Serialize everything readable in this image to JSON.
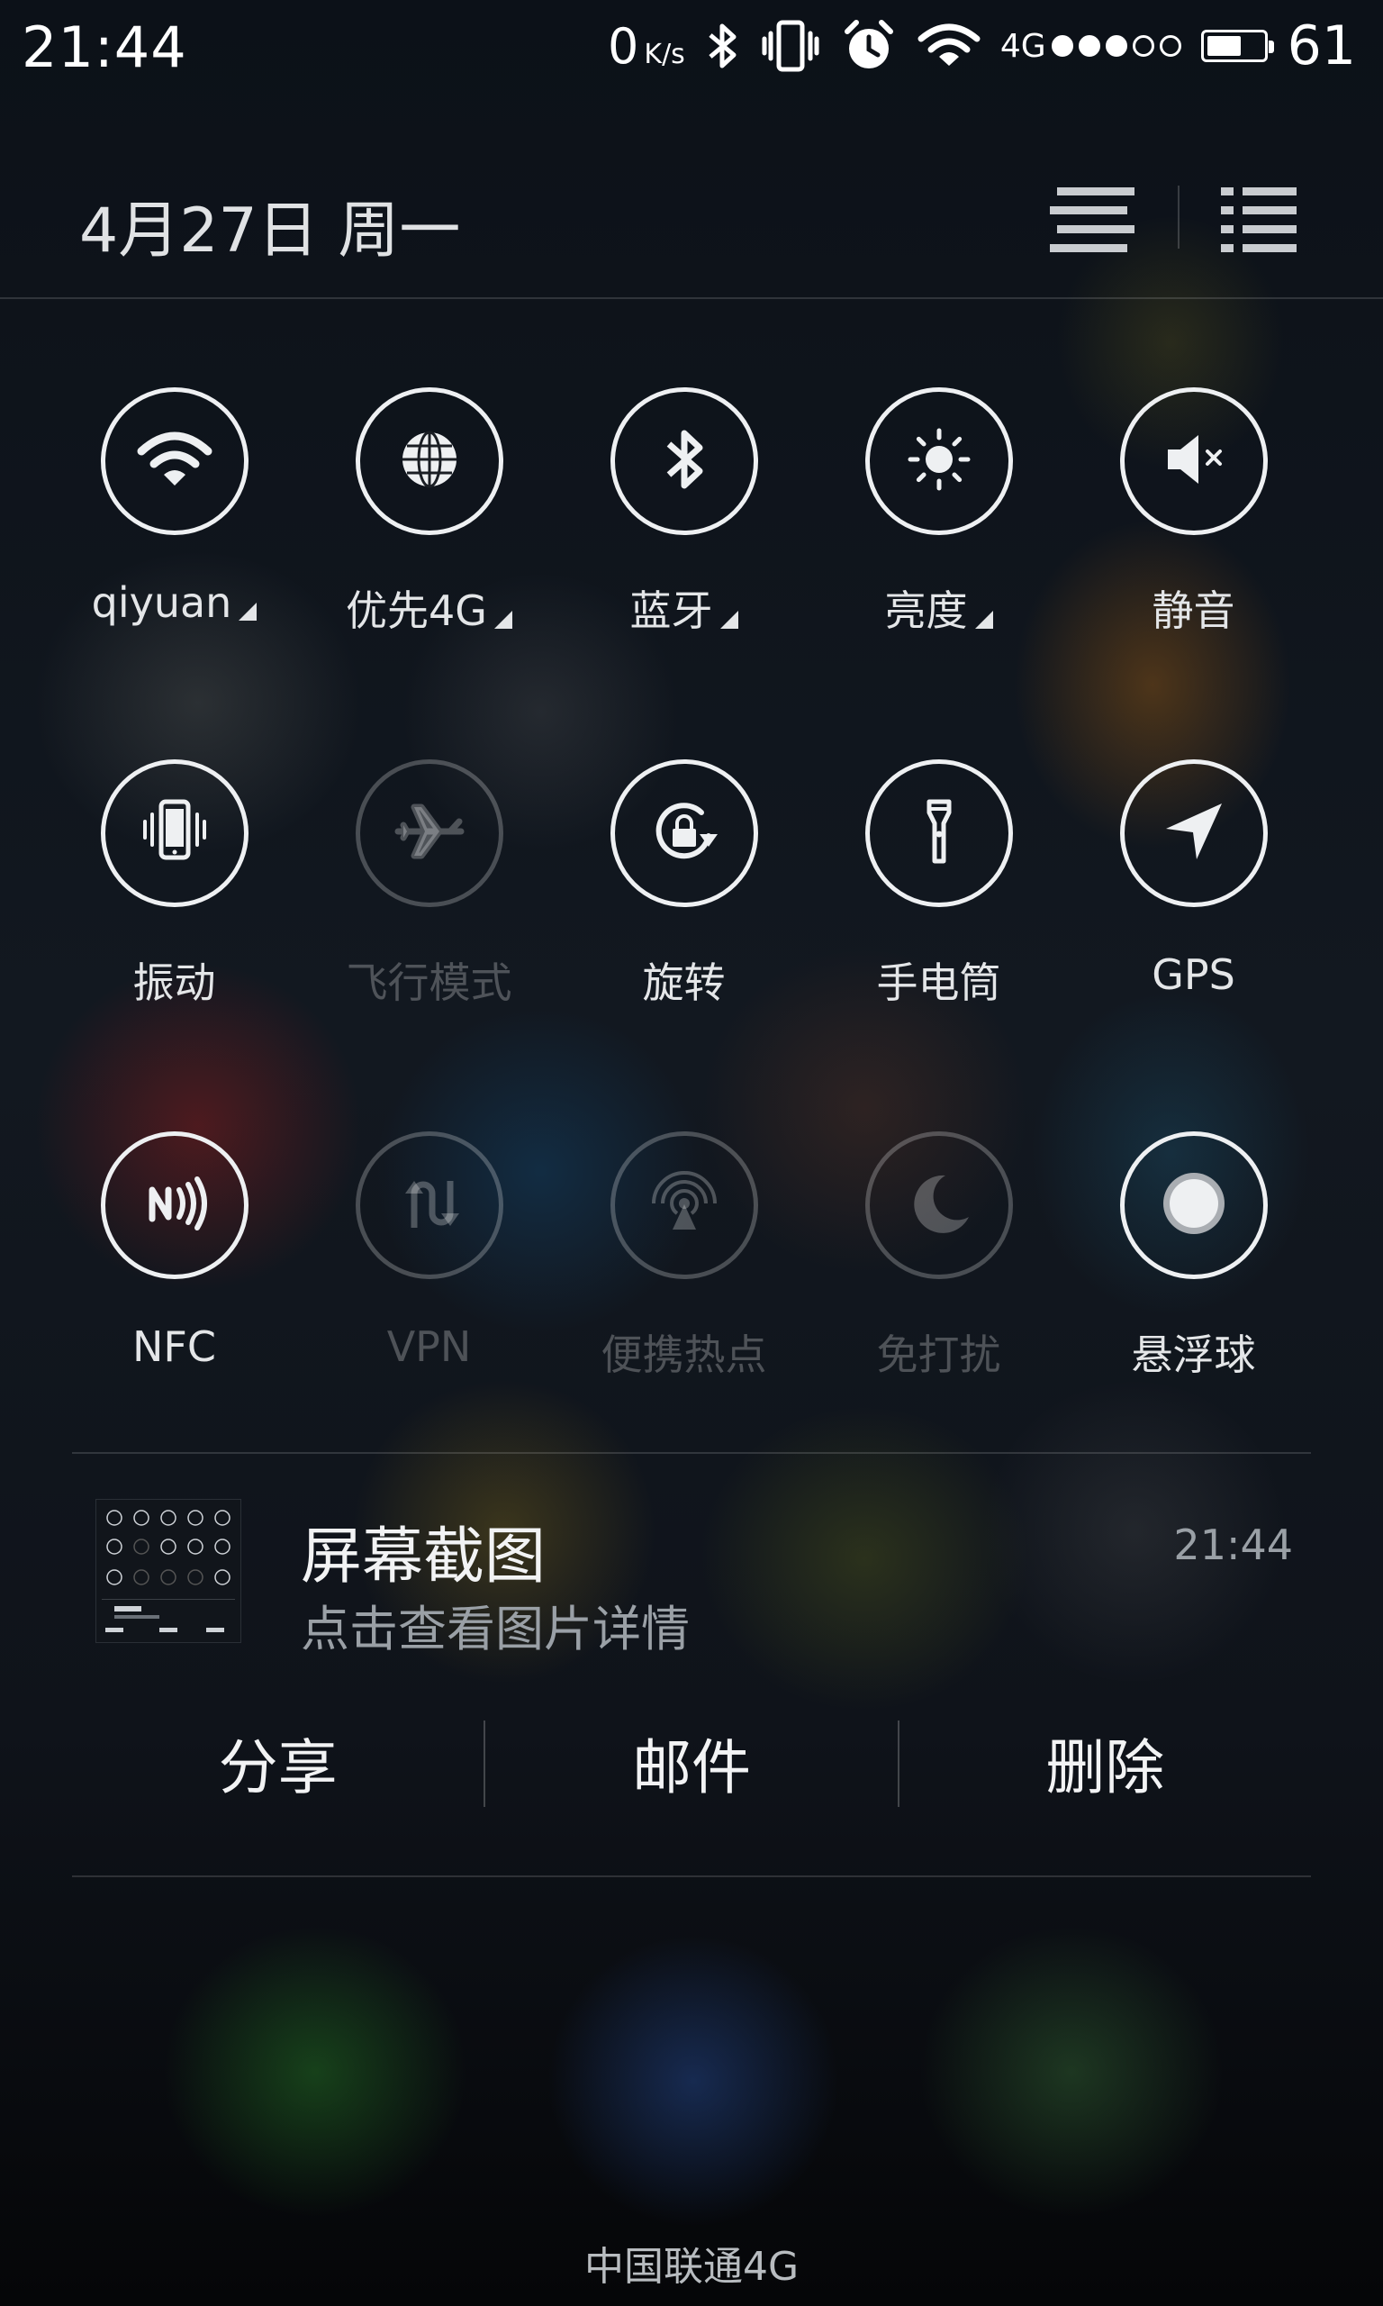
{
  "status_bar": {
    "time": "21:44",
    "net_speed": "0",
    "net_speed_unit": "K/s",
    "network_type": "4G",
    "signal_bars_filled": 3,
    "signal_bars_total": 5,
    "battery_level": 61,
    "battery_text": "61"
  },
  "header": {
    "date": "4月27日  周一",
    "icons": [
      "notification-list-icon",
      "list-view-icon"
    ]
  },
  "quick_settings": [
    {
      "label": "qiyuan",
      "icon": "wifi-icon",
      "state": "on",
      "has_menu": true
    },
    {
      "label": "优先4G",
      "icon": "globe-icon",
      "state": "on",
      "has_menu": true
    },
    {
      "label": "蓝牙",
      "icon": "bluetooth-icon",
      "state": "on",
      "has_menu": true
    },
    {
      "label": "亮度",
      "icon": "brightness-icon",
      "state": "on",
      "has_menu": true
    },
    {
      "label": "静音",
      "icon": "mute-icon",
      "state": "on",
      "has_menu": false
    },
    {
      "label": "振动",
      "icon": "vibrate-icon",
      "state": "on",
      "has_menu": false
    },
    {
      "label": "飞行模式",
      "icon": "airplane-icon",
      "state": "off",
      "has_menu": false
    },
    {
      "label": "旋转",
      "icon": "rotation-lock-icon",
      "state": "on",
      "has_menu": false
    },
    {
      "label": "手电筒",
      "icon": "flashlight-icon",
      "state": "on",
      "has_menu": false
    },
    {
      "label": "GPS",
      "icon": "location-arrow-icon",
      "state": "on",
      "has_menu": false
    },
    {
      "label": "NFC",
      "icon": "nfc-icon",
      "state": "on",
      "has_menu": false
    },
    {
      "label": "VPN",
      "icon": "vpn-icon",
      "state": "off",
      "has_menu": false
    },
    {
      "label": "便携热点",
      "icon": "hotspot-icon",
      "state": "off",
      "has_menu": false
    },
    {
      "label": "免打扰",
      "icon": "moon-icon",
      "state": "off",
      "has_menu": false
    },
    {
      "label": "悬浮球",
      "icon": "floating-ball-icon",
      "state": "on",
      "has_menu": false
    }
  ],
  "notification": {
    "title": "屏幕截图",
    "subtitle": "点击查看图片详情",
    "time": "21:44",
    "actions": [
      "分享",
      "邮件",
      "删除"
    ]
  },
  "carrier": "中国联通4G"
}
